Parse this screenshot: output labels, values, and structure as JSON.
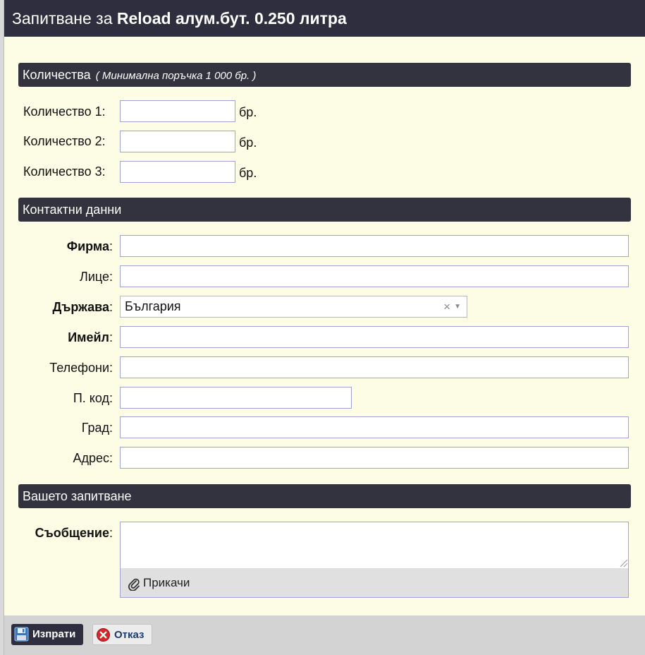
{
  "title": {
    "prefix": "Запитване за",
    "product": "Reload алум.бут. 0.250 литра"
  },
  "quantities": {
    "header": "Количества",
    "note": "( Минимална поръчка 1 000 бр. )",
    "unit": "бр.",
    "rows": [
      {
        "label": "Количество 1:",
        "value": ""
      },
      {
        "label": "Количество 2:",
        "value": ""
      },
      {
        "label": "Количество 3:",
        "value": ""
      }
    ]
  },
  "contacts": {
    "header": "Контактни данни",
    "firm_label": "Фирма",
    "person_label": "Лице:",
    "country_label": "Държава",
    "country_value": "България",
    "email_label": "Имейл",
    "phones_label": "Телефони:",
    "postcode_label": "П. код:",
    "city_label": "Град:",
    "address_label": "Адрес:",
    "colon": ":"
  },
  "inquiry": {
    "header": "Вашето запитване",
    "message_label": "Съобщение",
    "colon": ":",
    "attach_label": "Прикачи"
  },
  "footer": {
    "send_label": "Изпрати",
    "cancel_label": "Отказ"
  },
  "icons": {
    "clear": "×",
    "dropdown": "▼"
  },
  "colors": {
    "title_bar": "#2e2e3f",
    "section_header": "#33333f",
    "panel_bg": "#fdfde6",
    "input_border": "#9fa3d6"
  }
}
